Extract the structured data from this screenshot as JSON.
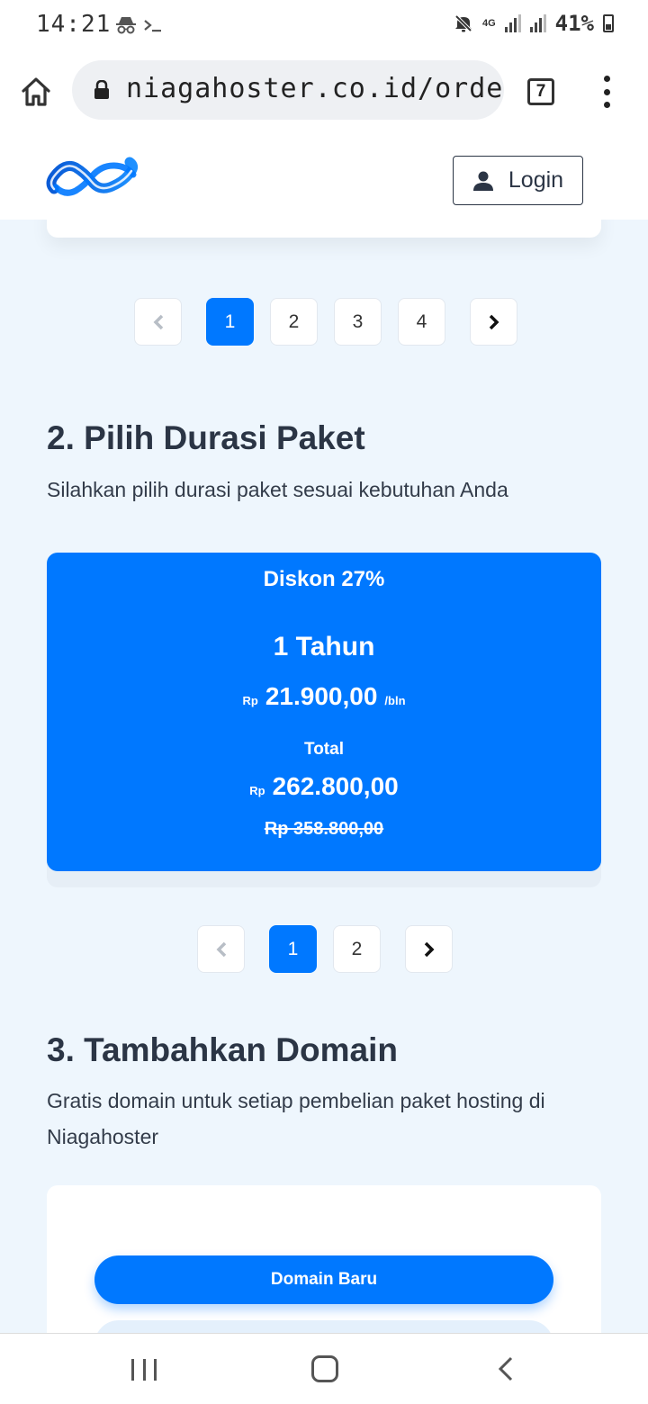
{
  "status_bar": {
    "time": "14:21",
    "left_icons": [
      "incognito-icon",
      "terminal-icon"
    ],
    "battery": "41%",
    "network": "4G"
  },
  "browser": {
    "url": "niagahoster.co.id/order",
    "tab_count": "7"
  },
  "header": {
    "login_label": "Login"
  },
  "pager1": {
    "pages": [
      "1",
      "2",
      "3",
      "4"
    ],
    "active": "1"
  },
  "section2": {
    "title": "2. Pilih Durasi Paket",
    "subtitle": "Silahkan pilih durasi paket sesuai kebutuhan Anda"
  },
  "price_card": {
    "discount": "Diskon 27%",
    "duration": "1 Tahun",
    "monthly_currency": "Rp",
    "monthly_amount": "21.900,00",
    "monthly_unit": "/bln",
    "total_label": "Total",
    "total_currency": "Rp",
    "total_amount": "262.800,00",
    "original_price": "Rp 358.800,00"
  },
  "pager2": {
    "pages": [
      "1",
      "2"
    ],
    "active": "1"
  },
  "section3": {
    "title": "3. Tambahkan Domain",
    "subtitle": "Gratis domain untuk setiap pembelian paket hosting di Niagahoster"
  },
  "domain": {
    "new_domain_label": "Domain Baru"
  },
  "colors": {
    "accent": "#0078ff",
    "background": "#eef6fd",
    "text": "#2b3545"
  }
}
